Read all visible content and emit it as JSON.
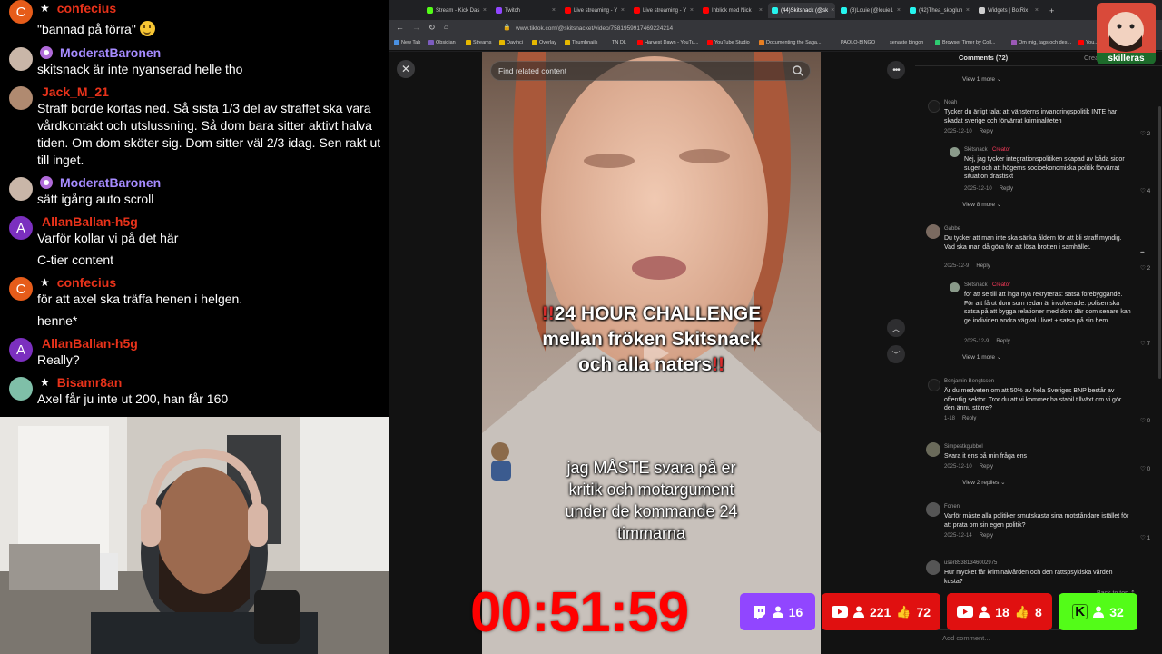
{
  "chat": {
    "messages": [
      {
        "user": "confecius",
        "user_color": "#e8321a",
        "avatar_letter": "C",
        "avatar_color": "#e65c1a",
        "badge": "star",
        "text": "\"bannad på förra\"",
        "emoji": "grinning-face"
      },
      {
        "user": "ModeratBaronen",
        "user_color": "#a68bff",
        "avatar_letter": "",
        "avatar_color": "#c9b6a8",
        "badge": "moderator",
        "text": "skitsnack är inte nyanserad helle tho"
      },
      {
        "user": "Jack_M_21",
        "user_color": "#e8321a",
        "avatar_letter": "",
        "avatar_color": "#b08a70",
        "badge": "",
        "text": "Straff borde kortas ned. Så sista 1/3 del av straffet ska vara vårdkontakt och utslussning. Så dom bara sitter aktivt halva tiden. Om dom sköter sig. Dom sitter väl 2/3 idag. Sen rakt ut till inget."
      },
      {
        "user": "ModeratBaronen",
        "user_color": "#a68bff",
        "avatar_letter": "",
        "avatar_color": "#c9b6a8",
        "badge": "moderator",
        "text": "sätt igång auto scroll"
      },
      {
        "user": "AllanBallan-h5g",
        "user_color": "#e8321a",
        "avatar_letter": "A",
        "avatar_color": "#7b2fbf",
        "badge": "",
        "text": "Varför kollar vi på det här",
        "extra": "C-tier content"
      },
      {
        "user": "confecius",
        "user_color": "#e8321a",
        "avatar_letter": "C",
        "avatar_color": "#e65c1a",
        "badge": "star",
        "text": "för att axel ska träffa henen i helgen.",
        "extra": "henne*"
      },
      {
        "user": "AllanBallan-h5g",
        "user_color": "#e8321a",
        "avatar_letter": "A",
        "avatar_color": "#7b2fbf",
        "badge": "",
        "text": "Really?"
      },
      {
        "user": "Bisamr8an",
        "user_color": "#e8321a",
        "avatar_letter": "",
        "avatar_color": "#7fbfa8",
        "badge": "star",
        "text": "Axel får ju inte ut 200, han får 160"
      }
    ]
  },
  "browser": {
    "tabs": [
      {
        "label": "Stream - Kick Das",
        "color": "#53fc18"
      },
      {
        "label": "Twitch",
        "color": "#9146ff"
      },
      {
        "label": "Live streaming - Y",
        "color": "#ff0000"
      },
      {
        "label": "Live streaming - Y",
        "color": "#ff0000"
      },
      {
        "label": "Inblick med Nick",
        "color": "#ff0000"
      },
      {
        "label": "(44)Skitsnack (@sk",
        "color": "#25f4ee",
        "active": true
      },
      {
        "label": "(8)Louie (@louie1",
        "color": "#25f4ee"
      },
      {
        "label": "(42)Thea_skoglun",
        "color": "#25f4ee"
      },
      {
        "label": "Widgets | BotRix",
        "color": "#cfcfcf"
      },
      {
        "label": "+",
        "color": ""
      }
    ],
    "url": "www.tiktok.com/@skitsnacket/video/7581959917469224214",
    "bookmarks": [
      "New Tab",
      "Obsidian",
      "Streams",
      "Davinci",
      "Overlay",
      "Thumbnails",
      "TN DL",
      "Harvest Dawn - YouTu...",
      "YouTube Studio",
      "Documenting the Saga...",
      "PAOLO-BINGO",
      "senaste bingon",
      "Browser Timer by Coll...",
      "Om mig, tags och des...",
      "You..."
    ]
  },
  "page": {
    "search_placeholder": "Find related content",
    "close_label": "✕",
    "more_label": "•••",
    "video_overlay": {
      "title_bang_left": "!!",
      "title_line1": "24 HOUR CHALLENGE",
      "title_line2": "mellan fröken Skitsnack",
      "title_line3": "och alla naters",
      "title_bang_right": "!!",
      "caption_line1": "jag MÅSTE svara på er",
      "caption_line2": "kritik och motargument",
      "caption_line3": "under de kommande 24",
      "caption_line4": "timmarna"
    },
    "comments_tab": "Comments (72)",
    "creator_tab": "Creator",
    "add_comment_placeholder": "Add comment...",
    "back_to_top": "Back to top",
    "comments": [
      {
        "kind": "viewmore",
        "text": "View 1 more"
      },
      {
        "kind": "comment",
        "name": "Noah",
        "text": "Tycker du ärligt talat att vänsterns invandringspolitik INTE har skadat sverige och förvärrat kriminaliteten",
        "date": "2025-12-10",
        "likes": "2"
      },
      {
        "kind": "reply",
        "name": "Skitsnack",
        "creator_label": "· Creator",
        "text": "Nej, jag tycker integrationspolitiken skapad av båda sidor suger och att högerns socioekonomiska politik förvärrat situation drastiskt",
        "date": "2025-12-10",
        "likes": "4"
      },
      {
        "kind": "viewmore",
        "text": "View 8 more"
      },
      {
        "kind": "comment",
        "name": "Gabbe",
        "text": "Du tycker att man inte ska sänka åldern för att bli straff myndig. Vad ska man då göra för att lösa brotten i samhället.",
        "date": "2025-12-9",
        "likes": "2"
      },
      {
        "kind": "reply",
        "name": "Skitsnack",
        "creator_label": "· Creator",
        "text": "för att se till att inga nya rekryteras: satsa förebyggande. För att få ut dom som redan är involverade: polisen ska satsa på att bygga relationer med dom där dom senare kan ge individen andra vägval i livet + satsa på sin hem",
        "date": "2025-12-9",
        "likes": "7"
      },
      {
        "kind": "viewmore",
        "text": "View 1 more"
      },
      {
        "kind": "comment",
        "name": "Benjamin Bengtsson",
        "text": "Är du medveten om att 50% av hela Sveriges BNP består av offentlig sektor. Tror du att vi kommer ha stabil tillväxt om vi gör den ännu större?",
        "date": "1-18",
        "likes": "0"
      },
      {
        "kind": "comment",
        "name": "Simpestkgubbel",
        "text": "Svara it ens på min fråga ens",
        "date": "2025-12-10",
        "likes": "0"
      },
      {
        "kind": "viewmore",
        "text": "View 2 replies"
      },
      {
        "kind": "comment",
        "name": "Fonen",
        "text": "Varför måste alla politiker smutskasta sina motståndare istället för att prata om sin egen politik?",
        "date": "2025-12-14",
        "likes": "1"
      },
      {
        "kind": "comment",
        "name": "user85381346002975",
        "text": "Hur mycket får kriminalvården och den rättspsykiska vården kosta?",
        "date": "2025-12-9",
        "likes": ""
      }
    ],
    "reply_label": "Reply"
  },
  "overlay": {
    "timer": "00:51:59",
    "stats": [
      {
        "platform": "twitch",
        "viewers": "16",
        "likes": "",
        "color": "#9146ff"
      },
      {
        "platform": "youtube",
        "viewers": "221",
        "likes": "72",
        "color": "#e01010"
      },
      {
        "platform": "youtube",
        "viewers": "18",
        "likes": "8",
        "color": "#e01010"
      },
      {
        "platform": "kick",
        "viewers": "32",
        "likes": "",
        "color": "#53fc18"
      }
    ],
    "logo_label": "skilleras"
  },
  "colors": {
    "timer": "#ff0000",
    "accent_creator": "#ff3b5c"
  }
}
